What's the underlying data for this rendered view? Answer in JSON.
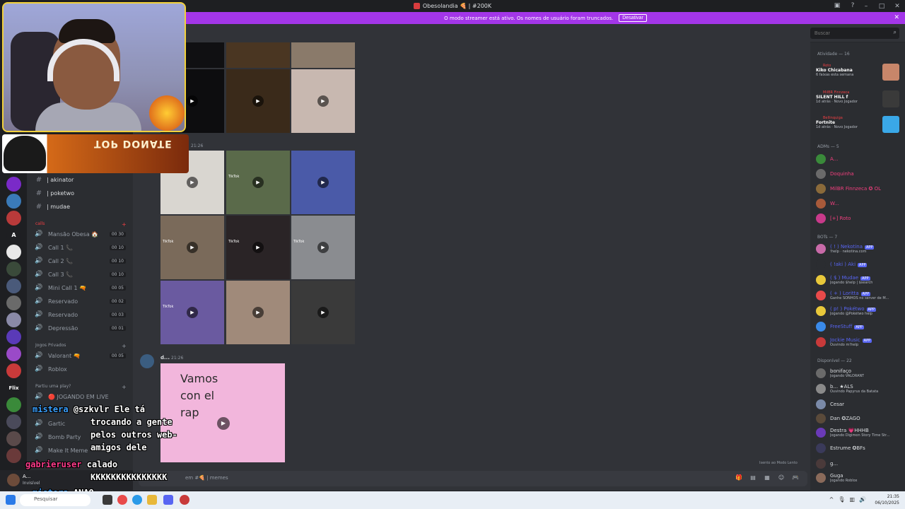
{
  "window": {
    "title": "Obesolandia 🍕 | #200K",
    "controls": [
      "–",
      "□",
      "✕"
    ]
  },
  "banner": {
    "text": "O modo streamer está ativo. Os nomes de usuário foram truncados.",
    "button": "Desativar"
  },
  "channels": {
    "text": [
      {
        "name": "| akinator"
      },
      {
        "name": "| poketwo"
      },
      {
        "name": "| mudae"
      }
    ],
    "calls_category": "calls",
    "voice": [
      {
        "name": "Mansão Obesa 🏠",
        "count": "00 30"
      },
      {
        "name": "Call 1 📞",
        "count": "00 10"
      },
      {
        "name": "Call 2 📞",
        "count": "00 10"
      },
      {
        "name": "Call 3 📞",
        "count": "00 10"
      },
      {
        "name": "Mini Call 1 🔫",
        "count": "00 05"
      },
      {
        "name": "Reservado",
        "count": "00 02"
      },
      {
        "name": "Reservado",
        "count": "00 03"
      },
      {
        "name": "Depressão",
        "count": "00 01"
      }
    ],
    "jogos_category": "Jogos Privados",
    "jogos": [
      {
        "name": "Valorant 🔫",
        "count": "00 05"
      },
      {
        "name": "Roblox",
        "count": ""
      }
    ],
    "play_category": "Partiu uma play?",
    "play": [
      {
        "name": "🔴 JOGANDO EM LIVE"
      },
      {
        "name": "Gartic"
      },
      {
        "name": "Bomb Party"
      },
      {
        "name": "Make It Meme"
      }
    ]
  },
  "user_panel": {
    "name": "A...",
    "status": "Invisível"
  },
  "chat": {
    "msg1_time": "21:26",
    "msg2_author": "d...",
    "msg2_time": "21:26",
    "video_text": [
      "Vamos",
      "con   el",
      "rap"
    ],
    "tiktok_label": "TikTok",
    "composer_placeholder": "em #🍕 | memes",
    "slowmode": "Isento ao Modo Lento"
  },
  "header": {
    "search_placeholder": "Buscar"
  },
  "members": {
    "activity_header": "Atividade — 16",
    "activities": [
      {
        "label": "Roto",
        "name": "Kiko Chicabana",
        "sub": "6 faixas esta semana"
      },
      {
        "label": "MilBR Finnzeca",
        "name": "SILENT HILL f",
        "sub": "1d atrás  ·  Novo Jogador"
      },
      {
        "label": "Bellinquiga",
        "name": "Fortnite",
        "sub": "1d atrás  ·  Novo Jogador"
      }
    ],
    "adms_header": "ADMs — 5",
    "adms": [
      {
        "name": "A..."
      },
      {
        "name": "Doquinha"
      },
      {
        "name": "MilBR Finnzeca ✪ OL"
      },
      {
        "name": "W..."
      },
      {
        "name": "[+]  Roto"
      }
    ],
    "bots_header": "BOTs — 7",
    "bots": [
      {
        "name": "( ! ) Nekotina",
        "tag": "APP",
        "act": "!help · nekotina.com"
      },
      {
        "name": "( !aki ) Aki",
        "tag": "APP",
        "act": ""
      },
      {
        "name": "( $ ) Mudae",
        "tag": "APP",
        "act": "Jogando $help | $search"
      },
      {
        "name": "( + ) Loritta",
        "tag": "APP",
        "act": "Ganhe SONHOS no server de M..."
      },
      {
        "name": "( p! ) Pokétwo",
        "tag": "APP",
        "act": "Jogando @Pokétwo help"
      },
      {
        "name": "FreeStuff",
        "tag": "APP",
        "act": ""
      },
      {
        "name": "Jockie Music",
        "tag": "APP",
        "act": "Ouvindo m!help"
      }
    ],
    "online_header": "Disponível — 22",
    "online": [
      {
        "name": "bonifaço",
        "act": "Jogando VALORANT"
      },
      {
        "name": "b... ★ALS",
        "act": "Ouvindo Papyrus da Batata"
      },
      {
        "name": "Cesar",
        "act": ""
      },
      {
        "name": "Dan ✪ZAGO",
        "act": ""
      },
      {
        "name": "Destra 💗HHHB",
        "act": "Jogando Digimon Story Time Str..."
      },
      {
        "name": "Estrume ✪BFs",
        "act": ""
      },
      {
        "name": "g...",
        "act": ""
      },
      {
        "name": "Guga",
        "act": "Jogando Roblox"
      }
    ]
  },
  "overlay": {
    "donate_label": "TOP DONATE",
    "chat_lines": [
      {
        "name": "mistera",
        "text": "@szkvlr Ele tá"
      },
      {
        "name": "",
        "text": "trocando a gente"
      },
      {
        "name": "",
        "text": "pelos outros web-"
      },
      {
        "name": "",
        "text": "amigos dele"
      },
      {
        "name": "gabrieruser",
        "text": "calado"
      },
      {
        "name": "",
        "text": "KKKKKKKKKKKKKKK"
      },
      {
        "name": "mistera",
        "text": "ANAO"
      }
    ]
  },
  "taskbar": {
    "search": "Pesquisar",
    "time": "21:35",
    "date": "06/10/2025"
  }
}
